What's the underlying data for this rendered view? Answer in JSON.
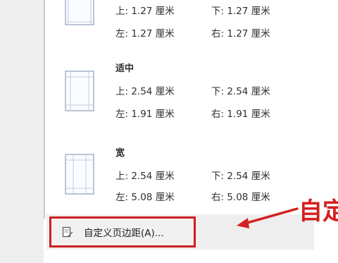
{
  "presets": [
    {
      "name": "",
      "top": "上: 1.27 厘米",
      "bottom": "下: 1.27 厘米",
      "left": "左: 1.27 厘米",
      "right": "右: 1.27 厘米"
    },
    {
      "name": "适中",
      "top": "上: 2.54 厘米",
      "bottom": "下: 2.54 厘米",
      "left": "左: 1.91 厘米",
      "right": "右: 1.91 厘米"
    },
    {
      "name": "宽",
      "top": "上: 2.54 厘米",
      "bottom": "下: 2.54 厘米",
      "left": "左: 5.08 厘米",
      "right": "右: 5.08 厘米"
    }
  ],
  "custom_item": {
    "label": "自定义页边距(A)..."
  },
  "annotation": {
    "callout_text": "自定",
    "color": "#d32020"
  }
}
